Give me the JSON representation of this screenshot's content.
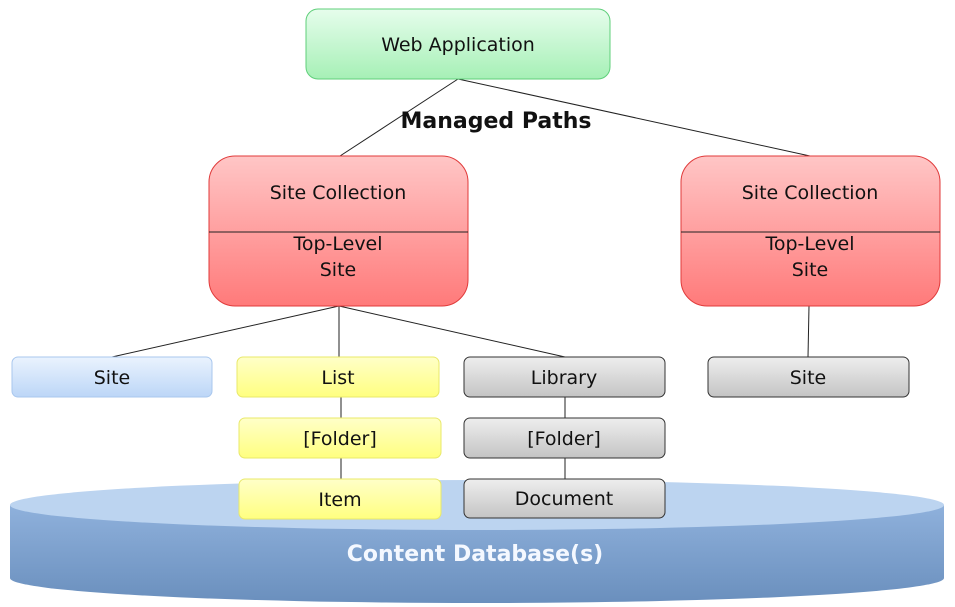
{
  "diagram": {
    "web_application": "Web Application",
    "managed_paths": "Managed Paths",
    "site_collection_left": {
      "title": "Site Collection",
      "line1": "Top-Level",
      "line2": "Site"
    },
    "site_collection_right": {
      "title": "Site Collection",
      "line1": "Top-Level",
      "line2": "Site"
    },
    "site_left": "Site",
    "list": "List",
    "list_folder": "[Folder]",
    "item": "Item",
    "library": "Library",
    "library_folder": "[Folder]",
    "document": "Document",
    "site_right": "Site",
    "content_database": "Content Database(s)"
  },
  "colors": {
    "web_application": "#b8f5c8",
    "site_collection": "#ff8a8a",
    "site": "#cfe2fb",
    "list": "#ffff99",
    "library": "#d4d4d4",
    "database": "#7ea3cf"
  }
}
